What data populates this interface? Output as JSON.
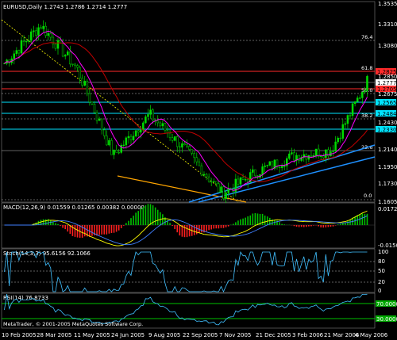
{
  "header": {
    "symbol_line": "EURUSD,Daily  1.2743 1.2786 1.2714 1.2777"
  },
  "price_axis": {
    "ticks": [
      "1.3535",
      "1.3310",
      "1.3080",
      "1.2850",
      "1.2675",
      "1.2430",
      "1.2140",
      "1.1950",
      "1.1730",
      "1.1605"
    ],
    "level_badges": [
      {
        "text": "1.2825",
        "color": "#ff2a2a"
      },
      {
        "text": "1.2777",
        "color": "#ffffff"
      },
      {
        "text": "1.2705",
        "color": "#ff2a2a"
      },
      {
        "text": "1.2565",
        "color": "#00e5ff"
      },
      {
        "text": "1.2484",
        "color": "#00e5ff"
      },
      {
        "text": "1.2330",
        "color": "#00e5ff"
      }
    ]
  },
  "fib_labels": [
    "76.4",
    "61.8",
    "50.0",
    "38.2",
    "23.6",
    "0.0"
  ],
  "indicators": {
    "macd": {
      "title": "MACD(12,26,9) 0.01559 0.01265 0.00382 0.00000",
      "top": "0.01724",
      "bottom": "-0.01503"
    },
    "stoch": {
      "title": "Stoch(14,3,3) 95.6156 92.1066",
      "levels": [
        "100",
        "80",
        "50",
        "20",
        "0"
      ]
    },
    "rsi": {
      "title": "RSI(14) 76.8733",
      "levels": [
        "70.0000",
        "30.0000"
      ]
    }
  },
  "dates": [
    "10 Feb 2005",
    "28 Mar 2005",
    "11 May 2005",
    "24 Jun 2005",
    "9 Aug 2005",
    "22 Sep 2005",
    "7 Nov 2005",
    "21 Dec 2005",
    "3 Feb 2006",
    "21 Mar 2006",
    "4 May 2006"
  ],
  "copyright": "MetaTrader, © 2001-2005 MetaQuotes Software Corp.",
  "colors": {
    "background": "#000000",
    "candle": "#00dd00",
    "ma_slow": "#c00000",
    "ma_fast": "#ff00ff",
    "fib_red": "#ff2a2a",
    "fib_cyan": "#00e5ff",
    "trend_blue": "#1e90ff",
    "trend_orange": "#ffa500",
    "macd_hist_pos": "#00c000",
    "macd_hist_neg": "#ff2020",
    "macd_line": "#ffff00",
    "macd_signal": "#4080ff",
    "stoch_main": "#40c0ff",
    "rsi_line": "#40c0ff",
    "rsi_level": "#00ff00"
  },
  "chart_data": {
    "type": "line",
    "title": "EURUSD,Daily",
    "ylim": [
      1.1605,
      1.3535
    ],
    "x": [
      "10 Feb 2005",
      "28 Mar 2005",
      "11 May 2005",
      "24 Jun 2005",
      "9 Aug 2005",
      "22 Sep 2005",
      "7 Nov 2005",
      "21 Dec 2005",
      "3 Feb 2006",
      "21 Mar 2006",
      "4 May 2006"
    ],
    "series": [
      {
        "name": "EURUSD",
        "values": [
          1.295,
          1.332,
          1.29,
          1.205,
          1.245,
          1.21,
          1.168,
          1.19,
          1.205,
          1.21,
          1.2777
        ]
      }
    ]
  }
}
